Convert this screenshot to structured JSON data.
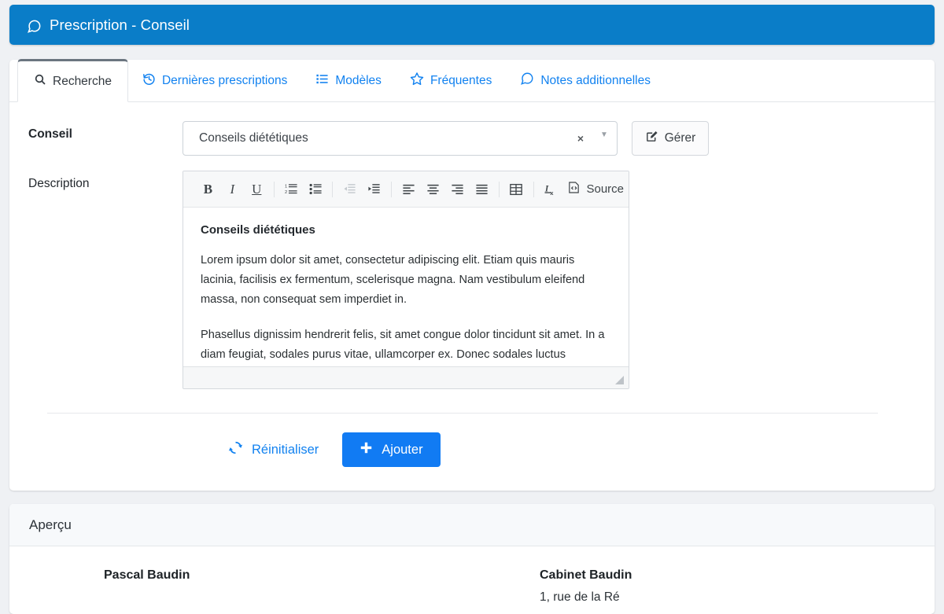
{
  "header": {
    "title": "Prescription - Conseil",
    "icon": "comment-icon",
    "bg_color": "#0a7dc8"
  },
  "tabs": [
    {
      "label": "Recherche",
      "icon": "search-icon",
      "active": true
    },
    {
      "label": "Dernières prescriptions",
      "icon": "history-icon",
      "active": false
    },
    {
      "label": "Modèles",
      "icon": "list-icon",
      "active": false
    },
    {
      "label": "Fréquentes",
      "icon": "star-icon",
      "active": false
    },
    {
      "label": "Notes additionnelles",
      "icon": "comment-icon",
      "active": false
    }
  ],
  "form": {
    "conseil_label": "Conseil",
    "description_label": "Description",
    "select": {
      "value": "Conseils diététiques",
      "placeholder": "Conseils diététiques",
      "clear_glyph": "×",
      "caret_glyph": "▼"
    },
    "manage_button": {
      "label": "Gérer",
      "icon": "pen-square-icon"
    }
  },
  "editor": {
    "toolbar": [
      {
        "name": "bold-icon",
        "glyph": "B",
        "disabled": false
      },
      {
        "name": "italic-icon",
        "glyph": "I",
        "disabled": false
      },
      {
        "name": "underline-icon",
        "glyph": "U",
        "disabled": false
      },
      {
        "name": "numbered-list-icon",
        "glyph": "",
        "disabled": false
      },
      {
        "name": "bulleted-list-icon",
        "glyph": "",
        "disabled": false
      },
      {
        "name": "outdent-icon",
        "glyph": "",
        "disabled": true
      },
      {
        "name": "indent-icon",
        "glyph": "",
        "disabled": false
      },
      {
        "name": "align-left-icon",
        "glyph": "",
        "disabled": false
      },
      {
        "name": "align-center-icon",
        "glyph": "",
        "disabled": false
      },
      {
        "name": "align-right-icon",
        "glyph": "",
        "disabled": false
      },
      {
        "name": "align-justify-icon",
        "glyph": "",
        "disabled": false
      },
      {
        "name": "table-icon",
        "glyph": "",
        "disabled": false
      },
      {
        "name": "remove-format-icon",
        "glyph": "",
        "disabled": false
      }
    ],
    "source_label": "Source",
    "content": {
      "heading": "Conseils diététiques",
      "paragraphs": [
        "Lorem ipsum dolor sit amet, consectetur adipiscing elit. Etiam quis mauris lacinia, facilisis ex fermentum, scelerisque magna. Nam vestibulum eleifend massa, non consequat sem imperdiet in.",
        "Phasellus dignissim hendrerit felis, sit amet congue dolor tincidunt sit amet. In a diam feugiat, sodales purus vitae, ullamcorper ex. Donec sodales luctus bibendum. Duis ultricies dapibus interdum."
      ]
    }
  },
  "actions": {
    "reset": {
      "label": "Réinitialiser",
      "icon": "refresh-icon"
    },
    "add": {
      "label": "Ajouter",
      "icon": "plus-icon",
      "color": "#117bf3"
    }
  },
  "preview": {
    "title": "Aperçu",
    "left": {
      "name": "Pascal Baudin",
      "sub": ""
    },
    "right": {
      "name": "Cabinet Baudin",
      "sub": "1, rue de la Ré"
    }
  }
}
